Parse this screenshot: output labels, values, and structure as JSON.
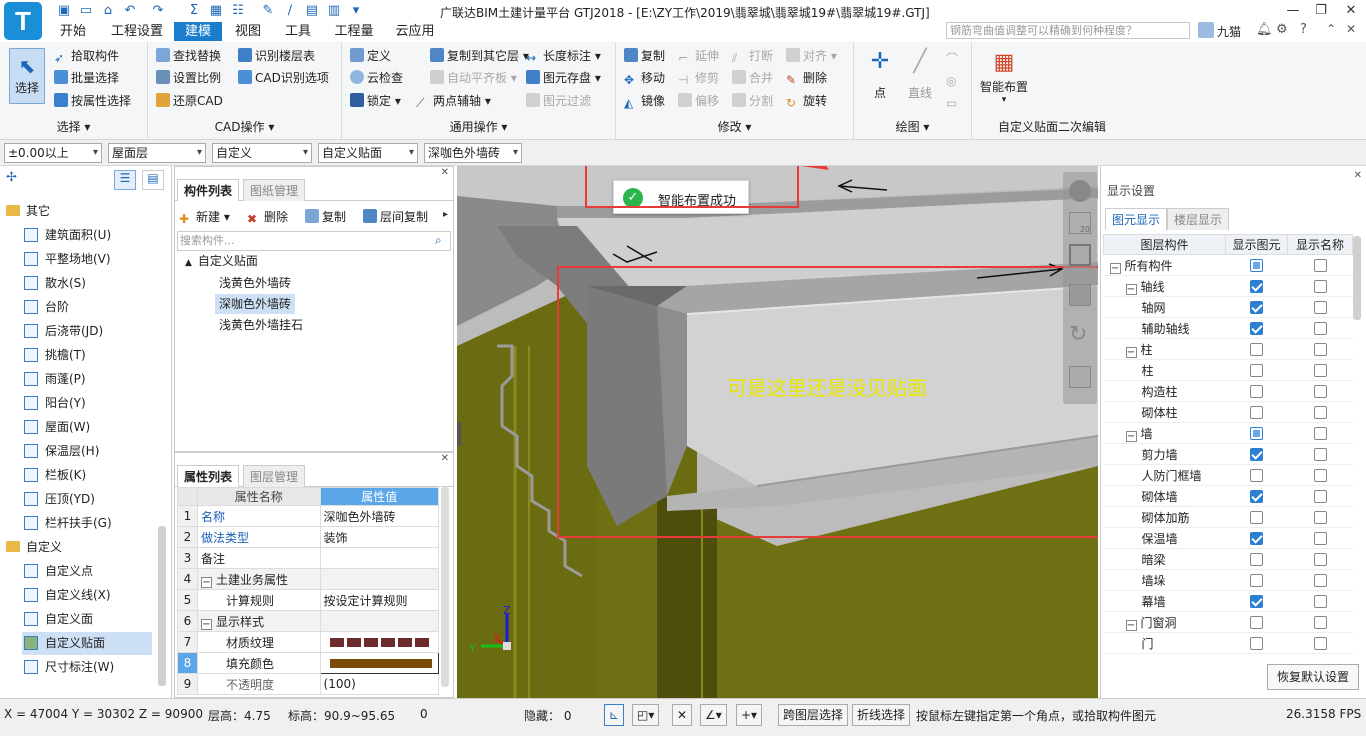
{
  "app": {
    "title": "广联达BIM土建计量平台 GTJ2018 - [E:\\ZY工作\\2019\\翡翠城\\翡翠城19#\\翡翠城19#.GTJ]",
    "logo": "T",
    "user": "九猫",
    "help_search_placeholder": "钢筋弯曲值调整可以精确到何种程度？"
  },
  "menu": [
    "开始",
    "工程设置",
    "建模",
    "视图",
    "工具",
    "工程量",
    "云应用"
  ],
  "menu_active_index": 2,
  "ribbon": {
    "select": {
      "label": "选择",
      "group": "选择",
      "items": [
        "拾取构件",
        "批量选择",
        "按属性选择"
      ]
    },
    "cad": {
      "group": "CAD操作",
      "items": [
        "查找替换",
        "识别楼层表",
        "设置比例",
        "CAD识别选项",
        "还原CAD"
      ]
    },
    "general": {
      "group": "通用操作",
      "items": [
        "定义",
        "复制到其它层",
        "长度标注",
        "云检查",
        "自动平齐板",
        "图元存盘",
        "锁定",
        "两点辅轴",
        "图元过滤"
      ]
    },
    "modify": {
      "group": "修改",
      "items": [
        "复制",
        "延伸",
        "打断",
        "对齐",
        "移动",
        "修剪",
        "合并",
        "删除",
        "镜像",
        "偏移",
        "分割",
        "旋转"
      ]
    },
    "draw": {
      "group": "绘图",
      "items": [
        "点",
        "直线"
      ]
    },
    "smart": {
      "group": "自定义贴面二次编辑",
      "items": [
        "智能布置"
      ]
    }
  },
  "filters": [
    "±0.00以上",
    "屋面层",
    "自定义",
    "自定义贴面",
    "深咖色外墙砖"
  ],
  "nav": {
    "group_other": "其它",
    "other_items": [
      "建筑面积(U)",
      "平整场地(V)",
      "散水(S)",
      "台阶",
      "后浇带(JD)",
      "挑檐(T)",
      "雨蓬(P)",
      "阳台(Y)",
      "屋面(W)",
      "保温层(H)",
      "栏板(K)",
      "压顶(YD)",
      "栏杆扶手(G)"
    ],
    "group_custom": "自定义",
    "custom_items": [
      "自定义点",
      "自定义线(X)",
      "自定义面",
      "自定义贴面",
      "尺寸标注(W)"
    ],
    "selected": "自定义贴面"
  },
  "components": {
    "tabs": [
      "构件列表",
      "图纸管理"
    ],
    "toolbar": [
      "新建",
      "删除",
      "复制",
      "层间复制"
    ],
    "search_placeholder": "搜索构件...",
    "root": "自定义贴面",
    "children": [
      "浅黄色外墙砖",
      "深咖色外墙砖",
      "浅黄色外墙挂石"
    ],
    "selected": "深咖色外墙砖"
  },
  "properties": {
    "tabs": [
      "属性列表",
      "图层管理"
    ],
    "headers": [
      "属性名称",
      "属性值"
    ],
    "rows": [
      {
        "n": "1",
        "name": "名称",
        "value": "深咖色外墙砖"
      },
      {
        "n": "2",
        "name": "做法类型",
        "value": "装饰"
      },
      {
        "n": "3",
        "name": "备注",
        "value": ""
      },
      {
        "n": "4",
        "name": "土建业务属性",
        "value": ""
      },
      {
        "n": "5",
        "name": "计算规则",
        "value": "按设定计算规则"
      },
      {
        "n": "6",
        "name": "显示样式",
        "value": ""
      },
      {
        "n": "7",
        "name": "材质纹理",
        "value": ""
      },
      {
        "n": "8",
        "name": "填充颜色",
        "value": ""
      },
      {
        "n": "9",
        "name": "不透明度",
        "value": "(100)"
      }
    ]
  },
  "viewport": {
    "toast": "智能布置成功",
    "annotation": "可是这里还是没见贴面",
    "axis": {
      "x": "X",
      "y": "Y",
      "z": "Z"
    },
    "view_number": "20"
  },
  "display": {
    "title": "显示设置",
    "tabs": [
      "图元显示",
      "楼层显示"
    ],
    "headers": [
      "图层构件",
      "显示图元",
      "显示名称"
    ],
    "rows": [
      {
        "label": "所有构件",
        "level": 0,
        "exp": "−",
        "show": "part",
        "name": false
      },
      {
        "label": "轴线",
        "level": 1,
        "exp": "−",
        "show": "on",
        "name": false
      },
      {
        "label": "轴网",
        "level": 2,
        "exp": "",
        "show": "on",
        "name": false
      },
      {
        "label": "辅助轴线",
        "level": 2,
        "exp": "",
        "show": "on",
        "name": false
      },
      {
        "label": "柱",
        "level": 1,
        "exp": "−",
        "show": "off",
        "name": false
      },
      {
        "label": "柱",
        "level": 2,
        "exp": "",
        "show": "off",
        "name": false
      },
      {
        "label": "构造柱",
        "level": 2,
        "exp": "",
        "show": "off",
        "name": false
      },
      {
        "label": "砌体柱",
        "level": 2,
        "exp": "",
        "show": "off",
        "name": false
      },
      {
        "label": "墙",
        "level": 1,
        "exp": "−",
        "show": "part",
        "name": false
      },
      {
        "label": "剪力墙",
        "level": 2,
        "exp": "",
        "show": "on",
        "name": false
      },
      {
        "label": "人防门框墙",
        "level": 2,
        "exp": "",
        "show": "off",
        "name": false
      },
      {
        "label": "砌体墙",
        "level": 2,
        "exp": "",
        "show": "on",
        "name": false
      },
      {
        "label": "砌体加筋",
        "level": 2,
        "exp": "",
        "show": "off",
        "name": false
      },
      {
        "label": "保温墙",
        "level": 2,
        "exp": "",
        "show": "on",
        "name": false
      },
      {
        "label": "暗梁",
        "level": 2,
        "exp": "",
        "show": "off",
        "name": false
      },
      {
        "label": "墙垛",
        "level": 2,
        "exp": "",
        "show": "off",
        "name": false
      },
      {
        "label": "幕墙",
        "level": 2,
        "exp": "",
        "show": "on",
        "name": false
      },
      {
        "label": "门窗洞",
        "level": 1,
        "exp": "−",
        "show": "off",
        "name": false
      },
      {
        "label": "门",
        "level": 2,
        "exp": "",
        "show": "off",
        "name": false
      }
    ],
    "reset": "恢复默认设置"
  },
  "status": {
    "coords": "X = 47004 Y = 30302 Z = 90900",
    "floor_height": "层高：4.75",
    "elevation": "标高：90.9~95.65",
    "zero": "0",
    "hidden": "隐藏： 0",
    "cross_layer": "跨图层选择",
    "polyline": "折线选择",
    "hint": "按鼠标左键指定第一个角点，或拾取构件图元",
    "fps": "26.3158 FPS"
  }
}
